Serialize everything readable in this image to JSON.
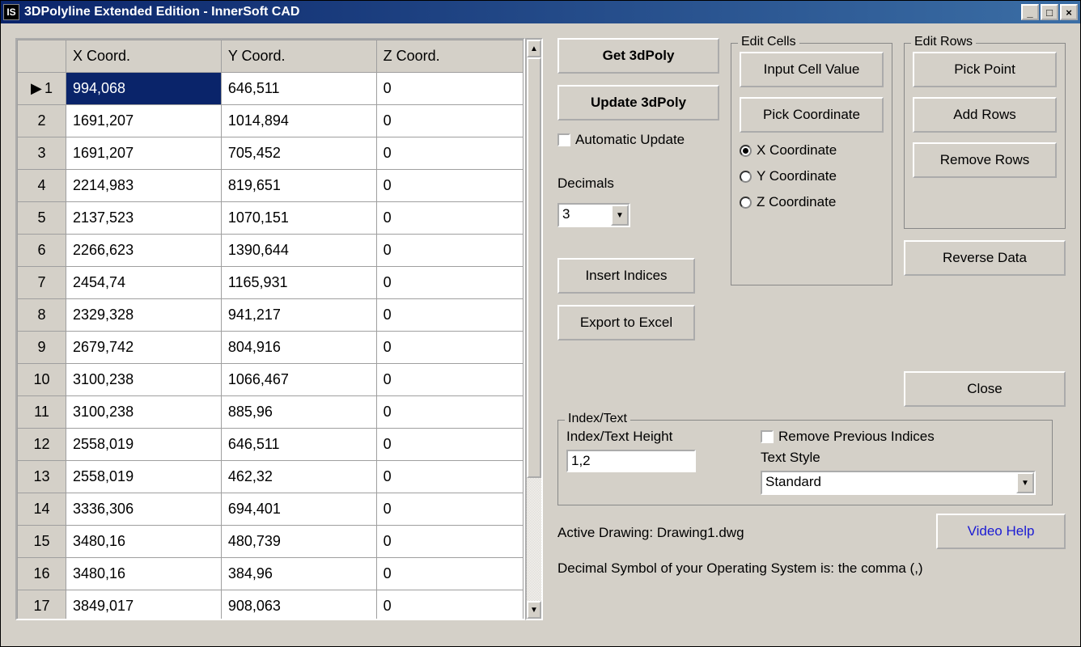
{
  "titlebar": {
    "icon_text": "IS",
    "title": "3DPolyline Extended Edition - InnerSoft CAD"
  },
  "grid": {
    "headers": [
      "",
      "X Coord.",
      "Y Coord.",
      "Z Coord."
    ],
    "rows": [
      {
        "n": "1",
        "x": "994,068",
        "y": "646,511",
        "z": "0",
        "selected": true
      },
      {
        "n": "2",
        "x": "1691,207",
        "y": "1014,894",
        "z": "0"
      },
      {
        "n": "3",
        "x": "1691,207",
        "y": "705,452",
        "z": "0"
      },
      {
        "n": "4",
        "x": "2214,983",
        "y": "819,651",
        "z": "0"
      },
      {
        "n": "5",
        "x": "2137,523",
        "y": "1070,151",
        "z": "0"
      },
      {
        "n": "6",
        "x": "2266,623",
        "y": "1390,644",
        "z": "0"
      },
      {
        "n": "7",
        "x": "2454,74",
        "y": "1165,931",
        "z": "0"
      },
      {
        "n": "8",
        "x": "2329,328",
        "y": "941,217",
        "z": "0"
      },
      {
        "n": "9",
        "x": "2679,742",
        "y": "804,916",
        "z": "0"
      },
      {
        "n": "10",
        "x": "3100,238",
        "y": "1066,467",
        "z": "0"
      },
      {
        "n": "11",
        "x": "3100,238",
        "y": "885,96",
        "z": "0"
      },
      {
        "n": "12",
        "x": "2558,019",
        "y": "646,511",
        "z": "0"
      },
      {
        "n": "13",
        "x": "2558,019",
        "y": "462,32",
        "z": "0"
      },
      {
        "n": "14",
        "x": "3336,306",
        "y": "694,401",
        "z": "0"
      },
      {
        "n": "15",
        "x": "3480,16",
        "y": "480,739",
        "z": "0"
      },
      {
        "n": "16",
        "x": "3480,16",
        "y": "384,96",
        "z": "0"
      },
      {
        "n": "17",
        "x": "3849,017",
        "y": "908,063",
        "z": "0"
      }
    ]
  },
  "buttons": {
    "get_3dpoly": "Get 3dPoly",
    "update_3dpoly": "Update 3dPoly",
    "insert_indices": "Insert Indices",
    "export_excel": "Export to Excel",
    "input_cell_value": "Input Cell Value",
    "pick_coordinate": "Pick Coordinate",
    "pick_point": "Pick Point",
    "add_rows": "Add Rows",
    "remove_rows": "Remove Rows",
    "reverse_data": "Reverse Data",
    "close": "Close",
    "video_help": "Video Help"
  },
  "checkboxes": {
    "automatic_update": "Automatic Update",
    "remove_previous_indices": "Remove Previous Indices"
  },
  "decimals": {
    "label": "Decimals",
    "value": "3"
  },
  "edit_cells": {
    "legend": "Edit Cells",
    "x_coord": "X Coordinate",
    "y_coord": "Y Coordinate",
    "z_coord": "Z Coordinate"
  },
  "edit_rows": {
    "legend": "Edit Rows"
  },
  "index_text": {
    "legend": "Index/Text",
    "height_label": "Index/Text Height",
    "height_value": "1,2",
    "text_style_label": "Text Style",
    "text_style_value": "Standard"
  },
  "status": {
    "active_drawing": "Active Drawing: Drawing1.dwg",
    "decimal_symbol": "Decimal Symbol of your Operating System is: the comma (,)"
  }
}
